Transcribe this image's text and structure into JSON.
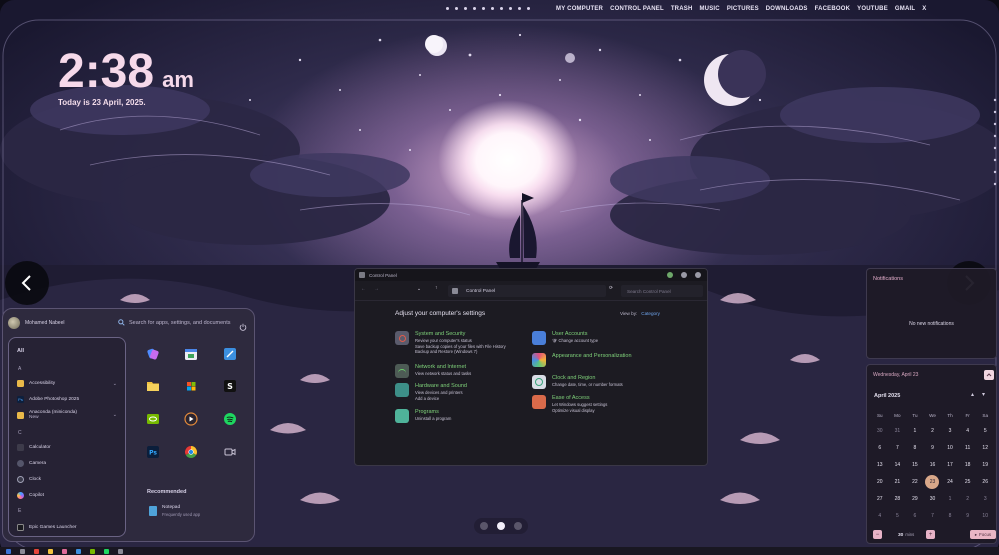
{
  "top_menu": {
    "items": [
      "MY COMPUTER",
      "CONTROL PANEL",
      "TRASH",
      "MUSIC",
      "PICTURES",
      "DOWNLOADS",
      "FACEBOOK",
      "YOUTUBE",
      "GMAIL",
      "X"
    ]
  },
  "clock": {
    "time": "2:38",
    "ampm": "am",
    "date": "Today is 23 April, 2025."
  },
  "start_menu": {
    "user_name": "Mohamed Nabeel",
    "search_placeholder": "Search for apps, settings, and documents",
    "all_label": "All",
    "letters": [
      "A",
      "C",
      "E"
    ],
    "apps": [
      {
        "name": "Accessibility",
        "type": "folder"
      },
      {
        "name": "Adobe Photoshop 2025",
        "type": "ps"
      },
      {
        "name": "Anaconda (miniconda)",
        "sub": "New",
        "type": "folder"
      },
      {
        "name": "Calculator",
        "type": "calc"
      },
      {
        "name": "Camera",
        "type": "camera"
      },
      {
        "name": "Clock",
        "type": "clock"
      },
      {
        "name": "Copilot",
        "type": "copilot"
      },
      {
        "name": "Epic Games Launcher",
        "type": "epic"
      }
    ],
    "recommended_title": "Recommended",
    "recommended": {
      "name": "Notepad",
      "sub": "Frequently used app"
    }
  },
  "control_panel": {
    "window_title": "Control Panel",
    "address": "Control Panel",
    "search_placeholder": "Search Control Panel",
    "heading": "Adjust your computer's settings",
    "view_by_label": "View by:",
    "view_by_value": "Category",
    "left_items": [
      {
        "title": "System and Security",
        "links": [
          "Review your computer's status",
          "Save backup copies of your files with File History",
          "Backup and Restore (Windows 7)"
        ]
      },
      {
        "title": "Network and Internet",
        "links": [
          "View network status and tasks"
        ]
      },
      {
        "title": "Hardware and Sound",
        "links": [
          "View devices and printers",
          "Add a device"
        ]
      },
      {
        "title": "Programs",
        "links": [
          "Uninstall a program"
        ]
      }
    ],
    "right_items": [
      {
        "title": "User Accounts",
        "links": [
          "Change account type"
        ]
      },
      {
        "title": "Appearance and Personalization",
        "links": []
      },
      {
        "title": "Clock and Region",
        "links": [
          "Change date, time, or number formats"
        ]
      },
      {
        "title": "Ease of Access",
        "links": [
          "Let Windows suggest settings",
          "Optimize visual display"
        ]
      }
    ]
  },
  "notifications": {
    "title": "Notifications",
    "empty_text": "No new notifications"
  },
  "calendar": {
    "header": "Wednesday, April 23",
    "month": "April 2025",
    "weekdays": [
      "Su",
      "Mo",
      "Tu",
      "We",
      "Th",
      "Fr",
      "Sa"
    ],
    "days": [
      {
        "d": "30",
        "dim": true
      },
      {
        "d": "31",
        "dim": true
      },
      {
        "d": "1"
      },
      {
        "d": "2"
      },
      {
        "d": "3"
      },
      {
        "d": "4"
      },
      {
        "d": "5"
      },
      {
        "d": "6"
      },
      {
        "d": "7"
      },
      {
        "d": "8"
      },
      {
        "d": "9"
      },
      {
        "d": "10"
      },
      {
        "d": "11"
      },
      {
        "d": "12"
      },
      {
        "d": "13"
      },
      {
        "d": "14"
      },
      {
        "d": "15"
      },
      {
        "d": "16"
      },
      {
        "d": "17"
      },
      {
        "d": "18"
      },
      {
        "d": "19"
      },
      {
        "d": "20"
      },
      {
        "d": "21"
      },
      {
        "d": "22"
      },
      {
        "d": "23",
        "today": true
      },
      {
        "d": "24"
      },
      {
        "d": "25"
      },
      {
        "d": "26"
      },
      {
        "d": "27"
      },
      {
        "d": "28"
      },
      {
        "d": "29"
      },
      {
        "d": "30"
      },
      {
        "d": "1",
        "dim": true
      },
      {
        "d": "2",
        "dim": true
      },
      {
        "d": "3",
        "dim": true
      },
      {
        "d": "4",
        "dim": true
      },
      {
        "d": "5",
        "dim": true
      },
      {
        "d": "6",
        "dim": true
      },
      {
        "d": "7",
        "dim": true
      },
      {
        "d": "8",
        "dim": true
      },
      {
        "d": "9",
        "dim": true
      },
      {
        "d": "10",
        "dim": true
      }
    ],
    "focus_minutes": "30",
    "focus_unit": "mins",
    "focus_button": "Focus",
    "minus": "−",
    "plus": "+"
  },
  "pager": {
    "count": 3,
    "active": 1
  },
  "colors": {
    "accent_pink": "#f6d9ea",
    "cp_green": "#7fd17a",
    "cp_blue": "#86b6f4",
    "today": "#d8a789"
  }
}
